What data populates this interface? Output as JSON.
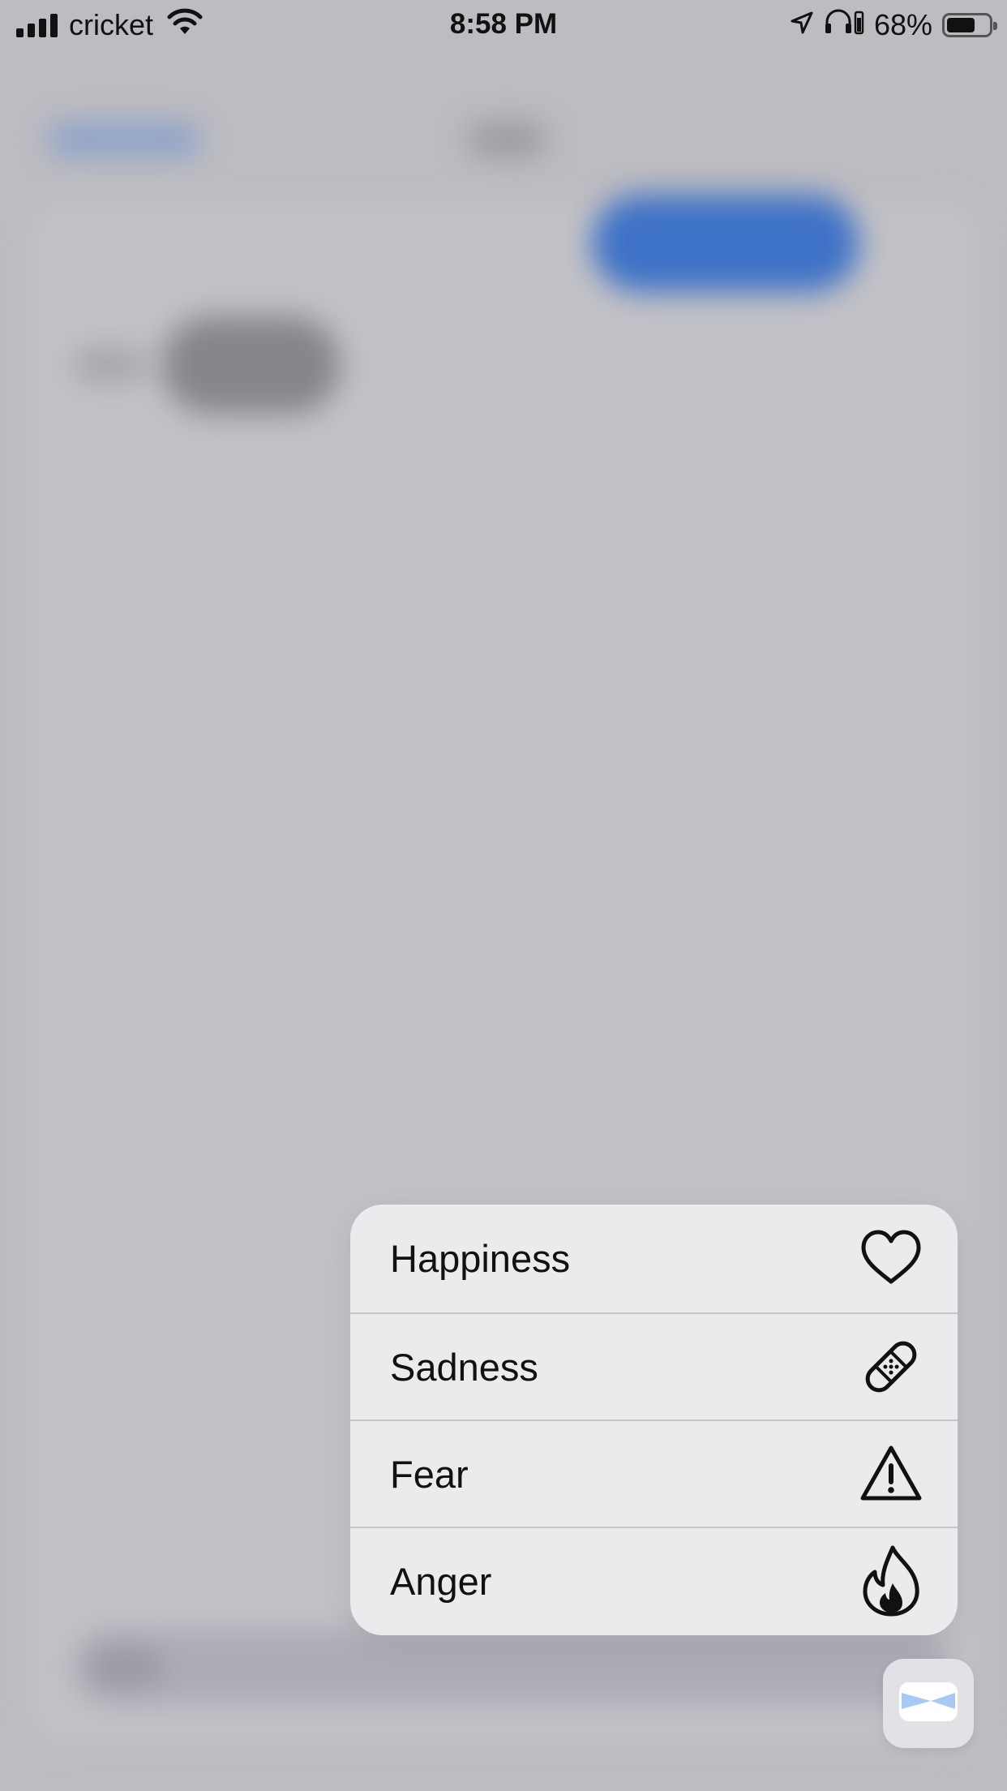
{
  "status_bar": {
    "carrier": "cricket",
    "time": "8:58 PM",
    "battery_percent": "68%",
    "battery_level": 0.68
  },
  "context_menu": {
    "items": [
      {
        "label": "Happiness",
        "icon": "heart-icon"
      },
      {
        "label": "Sadness",
        "icon": "bandage-icon"
      },
      {
        "label": "Fear",
        "icon": "warning-triangle-icon"
      },
      {
        "label": "Anger",
        "icon": "flame-icon"
      }
    ]
  },
  "app_button": {
    "icon": "app-logo-icon"
  },
  "colors": {
    "background": "#bdbcc1",
    "menu_background": "#ebebed",
    "sent_bubble": "#3e72c6"
  }
}
